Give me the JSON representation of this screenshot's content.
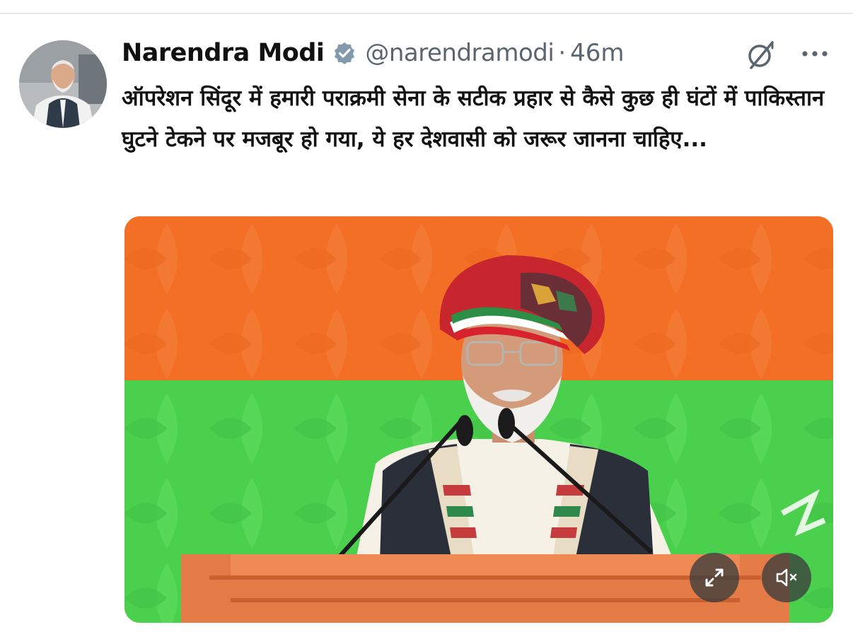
{
  "tweet": {
    "author": {
      "display_name": "Narendra Modi",
      "handle": "@narendramodi",
      "verified": true,
      "avatar_icon": "profile-photo"
    },
    "separator": "·",
    "time": "46m",
    "text": "ऑपरेशन सिंदूर में हमारी पराक्रमी सेना के सटीक प्रहार से कैसे कुछ ही घंटों में पाकिस्तान घुटने टेकने पर मजबूर हो गया, ये हर देशवासी को जरूर जानना चाहिए...",
    "actions": {
      "grok_icon": "grok-icon",
      "more_icon": "more-options-icon"
    },
    "media": {
      "type": "video",
      "description_icons": [
        "expand-icon",
        "mute-icon"
      ],
      "colors": {
        "top_band": "#f26f25",
        "bottom_band": "#4bd04e"
      }
    }
  },
  "colors": {
    "verified_badge": "#829aab",
    "secondary_text": "#5b6570",
    "primary_text": "#121212"
  }
}
